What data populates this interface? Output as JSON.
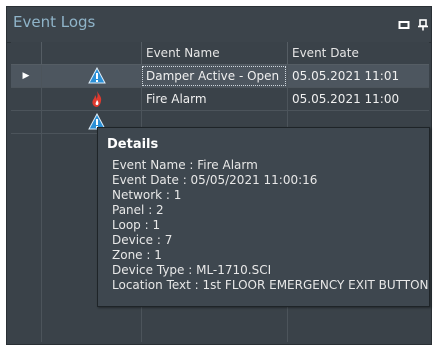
{
  "panel": {
    "title": "Event Logs",
    "restore_glyph": "▭",
    "pin_glyph": "⊥"
  },
  "grid": {
    "columns": [
      "",
      "",
      "Event Name",
      "Event Date"
    ],
    "rows": [
      {
        "icon": "warning-icon",
        "name": "Damper Active - Open",
        "date": "05.05.2021 11:01",
        "selected": true
      },
      {
        "icon": "fire-icon",
        "name": "Fire Alarm",
        "date": "05.05.2021 11:00",
        "selected": false
      },
      {
        "icon": "warning-icon",
        "name": "",
        "date": "",
        "selected": false
      }
    ],
    "row_indicator": "▶"
  },
  "tooltip": {
    "title": "Details",
    "lines": [
      "Event Name : Fire Alarm",
      "Event Date : 05/05/2021 11:00:16",
      "Network : 1",
      "Panel : 2",
      "Loop : 1",
      "Device : 7",
      "Zone : 1",
      "Device Type : ML-1710.SCI",
      "Location Text : 1st FLOOR EMERGENCY EXIT BUTTON"
    ]
  },
  "colors": {
    "panel_bg": "#3a4249",
    "title_text": "#8fb4c9",
    "selected_row": "#4d565f",
    "warning_icon": "#2a8fd6",
    "fire_icon": "#e03a2f"
  }
}
